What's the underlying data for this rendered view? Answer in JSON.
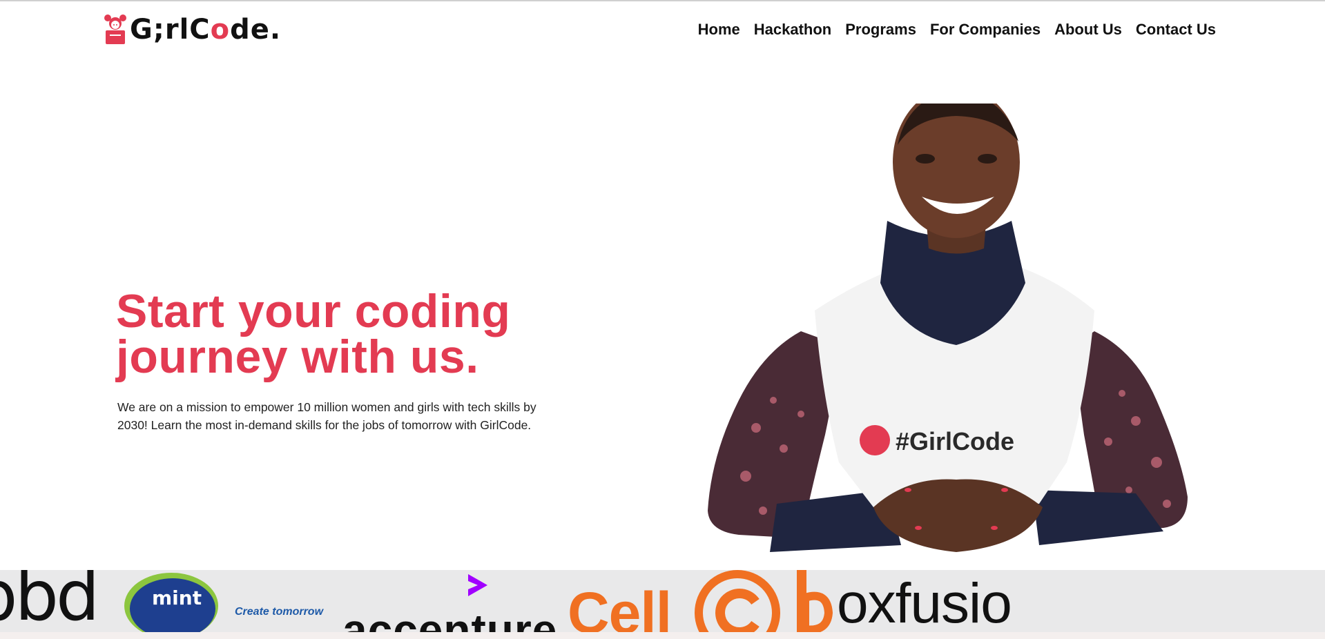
{
  "header": {
    "logo": {
      "text_before": "G",
      "text_i": ";",
      "text_mid": "rlC",
      "text_o": "o",
      "text_after": "de."
    },
    "nav": [
      {
        "label": "Home"
      },
      {
        "label": "Hackathon"
      },
      {
        "label": "Programs"
      },
      {
        "label": "For Companies"
      },
      {
        "label": "About Us"
      },
      {
        "label": "Contact Us"
      }
    ]
  },
  "hero": {
    "title_line1": "Start your coding",
    "title_line2": "journey with us.",
    "description": "We are on a mission to empower 10 million women and girls with tech skills by 2030! Learn the most in-demand skills for the jobs of tomorrow with GirlCode.",
    "shirt_text": "#GirlCode"
  },
  "partners": [
    {
      "name": "bbd",
      "text": "bbd"
    },
    {
      "name": "mint",
      "text": "mint",
      "tagline": "Create tomorrow"
    },
    {
      "name": "accenture",
      "text": "accenture"
    },
    {
      "name": "cellc",
      "text": "Cell"
    },
    {
      "name": "boxfusion",
      "text": "oxfusion"
    }
  ],
  "colors": {
    "brand": "#e33b52",
    "text": "#111111",
    "strip_bg": "#e9e9ea",
    "cellc_orange": "#f07022",
    "accenture_purple": "#a100ff",
    "mint_blue": "#1e5aa8",
    "mint_green": "#8cc63f"
  }
}
